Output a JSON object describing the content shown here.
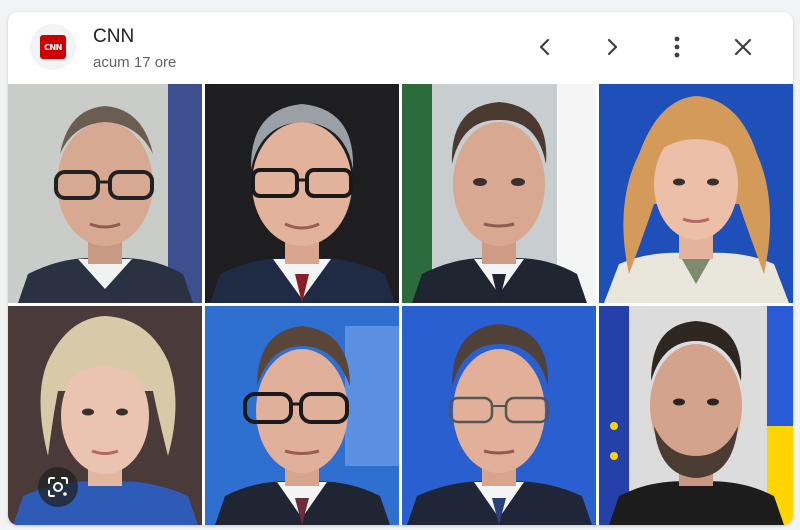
{
  "header": {
    "source_name": "CNN",
    "logo_text": "CNN",
    "time_label": "acum 17 ore"
  },
  "colors": {
    "brand": "#cc0000"
  },
  "icons": {
    "prev": "chevron-left-icon",
    "next": "chevron-right-icon",
    "more": "more-vert-icon",
    "close": "close-icon",
    "lens": "lens-icon"
  },
  "photos": [
    {
      "name": "portrait-1"
    },
    {
      "name": "portrait-2"
    },
    {
      "name": "portrait-3"
    },
    {
      "name": "portrait-4"
    },
    {
      "name": "portrait-5"
    },
    {
      "name": "portrait-6"
    },
    {
      "name": "portrait-7"
    },
    {
      "name": "portrait-8"
    }
  ]
}
